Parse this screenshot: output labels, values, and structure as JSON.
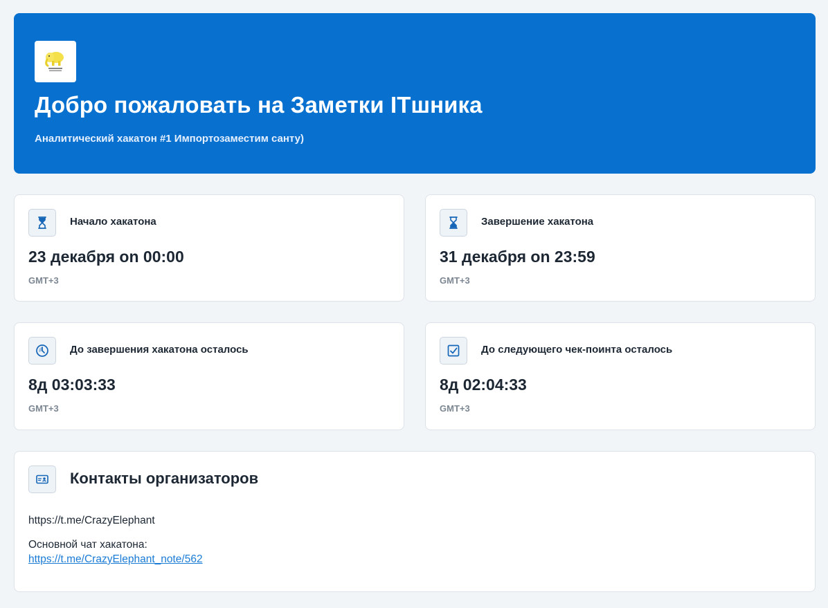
{
  "hero": {
    "title": "Добро пожаловать на Заметки ITшника",
    "subtitle": "Аналитический хакатон #1 Импортозаместим санту)",
    "background_color": "#0870cf"
  },
  "cards": [
    {
      "icon": "hourglass-start-icon",
      "label": "Начало хакатона",
      "value": "23 декабря on 00:00",
      "timezone": "GMT+3"
    },
    {
      "icon": "hourglass-end-icon",
      "label": "Завершение хакатона",
      "value": "31 декабря on 23:59",
      "timezone": "GMT+3"
    },
    {
      "icon": "clock-icon",
      "label": "До завершения хакатона осталось",
      "value": "8д 03:03:33",
      "timezone": "GMT+3"
    },
    {
      "icon": "checkbox-icon",
      "label": "До следующего чек-поинта осталось",
      "value": "8д 02:04:33",
      "timezone": "GMT+3"
    }
  ],
  "contacts": {
    "icon": "id-card-icon",
    "title": "Контакты организаторов",
    "organizer_link": "https://t.me/CrazyElephant",
    "chat_label": "Основной чат хакатона:",
    "chat_link": "https://t.me/CrazyElephant_note/562"
  },
  "colors": {
    "accent": "#0870cf",
    "link": "#1a7bd6",
    "icon": "#1666b8",
    "background": "#f2f5f7"
  }
}
